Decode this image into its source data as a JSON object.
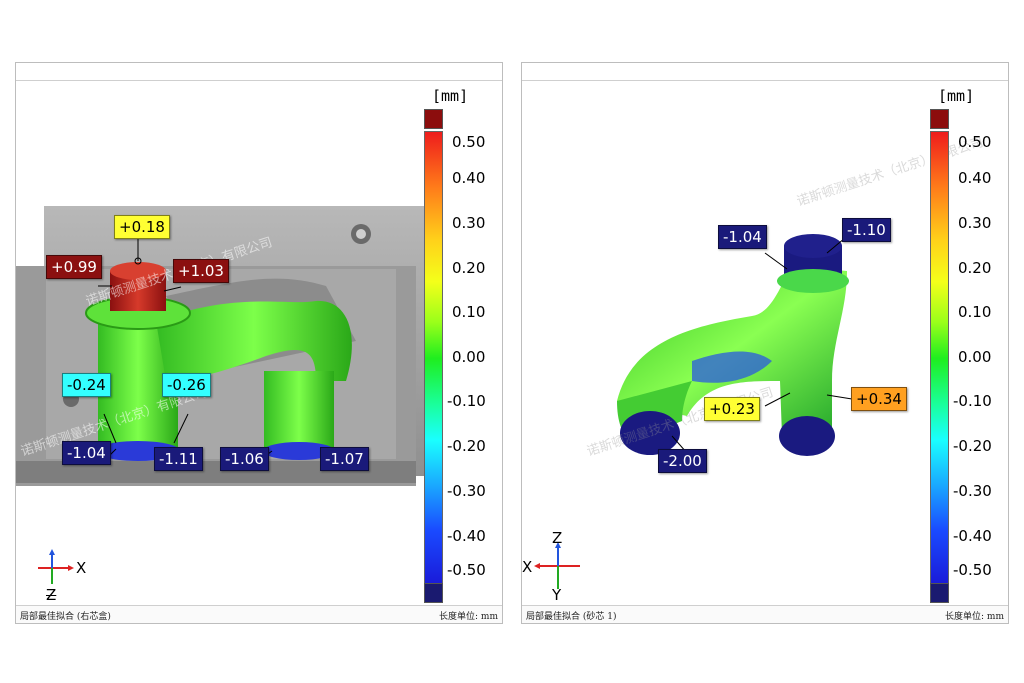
{
  "panels": [
    {
      "footer_left": "局部最佳拟合 (右芯盒)",
      "footer_right": "长度单位: mm",
      "unit": "[mm]",
      "scale_ticks": [
        "0.50",
        "0.40",
        "0.30",
        "0.20",
        "0.10",
        "0.00",
        "-0.10",
        "-0.20",
        "-0.30",
        "-0.40",
        "-0.50"
      ],
      "axes": {
        "horizontal": "X",
        "vertical": "Z"
      },
      "watermark": "诺斯顿测量技术（北京）有限公司",
      "labels": [
        "+0.18",
        "+0.99",
        "+1.03",
        "-0.24",
        "-0.26",
        "-1.04",
        "-1.11",
        "-1.06",
        "-1.07"
      ]
    },
    {
      "footer_left": "局部最佳拟合 (砂芯 1)",
      "footer_right": "长度单位: mm",
      "unit": "[mm]",
      "scale_ticks": [
        "0.50",
        "0.40",
        "0.30",
        "0.20",
        "0.10",
        "0.00",
        "-0.10",
        "-0.20",
        "-0.30",
        "-0.40",
        "-0.50"
      ],
      "axes": {
        "horizontal": "X",
        "vertical": "Z",
        "depth": "Y"
      },
      "watermark": "诺斯顿测量技术（北京）有限公司",
      "labels": [
        "-1.04",
        "-1.10",
        "+0.23",
        "+0.34",
        "-2.00"
      ]
    }
  ]
}
